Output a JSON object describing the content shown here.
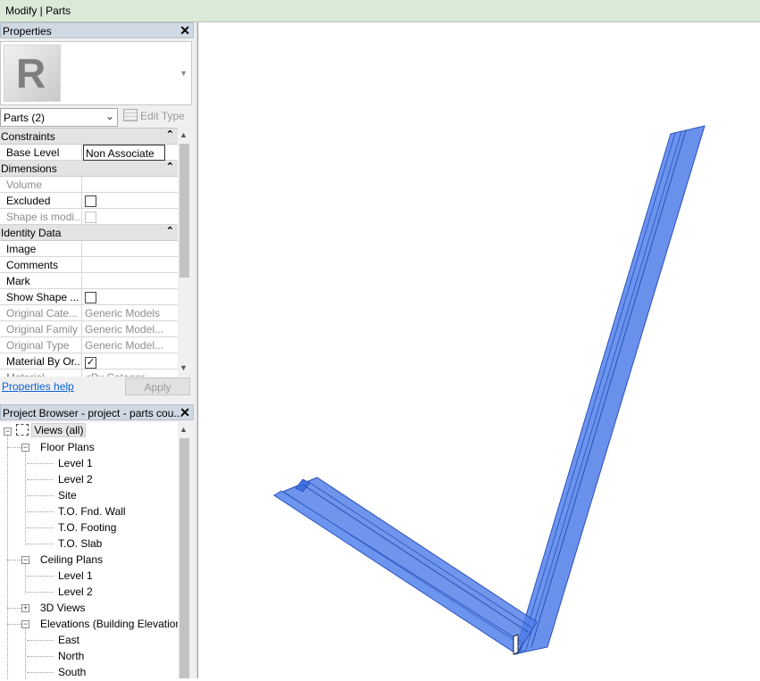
{
  "window": {
    "title": "Modify | Parts"
  },
  "properties": {
    "header": "Properties",
    "close_glyph": "✕",
    "type_logo_letter": "R",
    "selector": {
      "value": "Parts (2)"
    },
    "edit_type_label": "Edit Type",
    "groups": [
      {
        "label": "Constraints",
        "rows": [
          {
            "name": "Base Level",
            "value": "Non Associate",
            "state": "editing"
          }
        ]
      },
      {
        "label": "Dimensions",
        "rows": [
          {
            "name": "Volume",
            "value": "",
            "state": "disabled"
          },
          {
            "name": "Excluded",
            "value": "checkbox-unchecked",
            "state": "normal"
          },
          {
            "name": "Shape is modi...",
            "value": "checkbox-unchecked",
            "state": "disabled"
          }
        ]
      },
      {
        "label": "Identity Data",
        "rows": [
          {
            "name": "Image",
            "value": ""
          },
          {
            "name": "Comments",
            "value": ""
          },
          {
            "name": "Mark",
            "value": ""
          },
          {
            "name": "Show Shape ...",
            "value": "checkbox-unchecked"
          },
          {
            "name": "Original Cate...",
            "value": "Generic Models",
            "state": "disabled"
          },
          {
            "name": "Original Family",
            "value": "Generic Model...",
            "state": "disabled"
          },
          {
            "name": "Original Type",
            "value": "Generic Model...",
            "state": "disabled"
          },
          {
            "name": "Material By Or...",
            "value": "checkbox-checked"
          },
          {
            "name": "Material",
            "value": "<By Categor",
            "state": "disabled"
          }
        ]
      }
    ],
    "help_link": "Properties help",
    "apply_label": "Apply"
  },
  "project_browser": {
    "header": "Project Browser - project - parts cou...",
    "close_glyph": "✕",
    "nodes": [
      {
        "label": "Views (all)",
        "level": 0,
        "expanded": true,
        "selected": true
      },
      {
        "label": "Floor Plans",
        "level": 1,
        "expanded": true
      },
      {
        "label": "Level 1",
        "level": 2
      },
      {
        "label": "Level 2",
        "level": 2
      },
      {
        "label": "Site",
        "level": 2
      },
      {
        "label": "T.O. Fnd. Wall",
        "level": 2
      },
      {
        "label": "T.O. Footing",
        "level": 2
      },
      {
        "label": "T.O. Slab",
        "level": 2
      },
      {
        "label": "Ceiling Plans",
        "level": 1,
        "expanded": true
      },
      {
        "label": "Level 1",
        "level": 2
      },
      {
        "label": "Level 2",
        "level": 2
      },
      {
        "label": "3D Views",
        "level": 1,
        "expanded": false
      },
      {
        "label": "Elevations (Building Elevation",
        "level": 1,
        "expanded": true
      },
      {
        "label": "East",
        "level": 2
      },
      {
        "label": "North",
        "level": 2
      },
      {
        "label": "South",
        "level": 2
      }
    ]
  },
  "viewport": {
    "part_color": "#4f7ee8",
    "part_edge_color": "#2a4fb8"
  }
}
